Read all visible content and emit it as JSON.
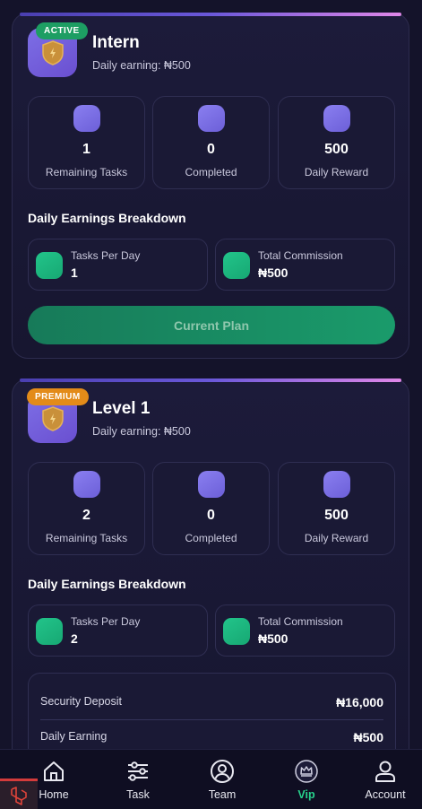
{
  "plans": [
    {
      "badge": "ACTIVE",
      "title": "Intern",
      "daily_earning": "Daily earning: ₦500",
      "stats": [
        {
          "value": "1",
          "label": "Remaining Tasks"
        },
        {
          "value": "0",
          "label": "Completed"
        },
        {
          "value": "500",
          "label": "Daily Reward"
        }
      ],
      "breakdown_title": "Daily Earnings Breakdown",
      "tasks_per_day_label": "Tasks Per Day",
      "tasks_per_day": "1",
      "total_commission_label": "Total Commission",
      "total_commission": "₦500",
      "button": "Current Plan"
    },
    {
      "badge": "PREMIUM",
      "title": "Level 1",
      "daily_earning": "Daily earning: ₦500",
      "stats": [
        {
          "value": "2",
          "label": "Remaining Tasks"
        },
        {
          "value": "0",
          "label": "Completed"
        },
        {
          "value": "500",
          "label": "Daily Reward"
        }
      ],
      "breakdown_title": "Daily Earnings Breakdown",
      "tasks_per_day_label": "Tasks Per Day",
      "tasks_per_day": "2",
      "total_commission_label": "Total Commission",
      "total_commission": "₦500",
      "details": [
        {
          "label": "Security Deposit",
          "value": "₦16,000"
        },
        {
          "label": "Daily Earning",
          "value": "₦500"
        }
      ]
    }
  ],
  "nav": [
    {
      "label": "Home",
      "icon": "home-icon"
    },
    {
      "label": "Task",
      "icon": "sliders-icon"
    },
    {
      "label": "Team",
      "icon": "user-circle-icon"
    },
    {
      "label": "Vip",
      "icon": "crown-icon",
      "active": true
    },
    {
      "label": "Account",
      "icon": "person-icon"
    }
  ],
  "colors": {
    "background": "#14132a",
    "accent_green": "#1d9e63",
    "active_nav": "#27d28c",
    "premium_badge": "#e38b19",
    "icon_purple": "#7d6fe6"
  }
}
